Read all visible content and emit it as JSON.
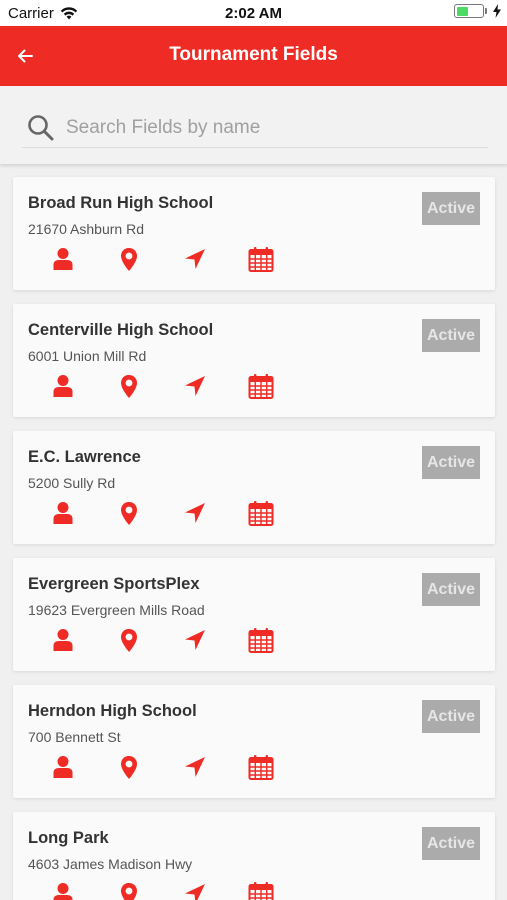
{
  "status_bar": {
    "carrier": "Carrier",
    "time": "2:02 AM",
    "battery_level": 0.5
  },
  "header": {
    "title": "Tournament Fields",
    "back_icon": "arrow-left-icon",
    "background_color": "#ee2b24"
  },
  "search": {
    "placeholder": "Search Fields by name",
    "value": ""
  },
  "fields": [
    {
      "name": "Broad Run High School",
      "address": "21670 Ashburn Rd",
      "status": "Active"
    },
    {
      "name": "Centerville High School",
      "address": "6001 Union Mill Rd",
      "status": "Active"
    },
    {
      "name": "E.C. Lawrence",
      "address": "5200 Sully Rd",
      "status": "Active"
    },
    {
      "name": "Evergreen SportsPlex",
      "address": "19623 Evergreen Mills Road",
      "status": "Active"
    },
    {
      "name": "Herndon High School",
      "address": "700 Bennett St",
      "status": "Active"
    },
    {
      "name": "Long Park",
      "address": "4603 James Madison Hwy",
      "status": "Active"
    }
  ],
  "card_actions": [
    "contact-icon",
    "map-pin-icon",
    "navigation-arrow-icon",
    "calendar-icon"
  ],
  "colors": {
    "accent": "#ee2b24",
    "badge_bg": "#ababab",
    "badge_text": "#e6e6e6"
  }
}
